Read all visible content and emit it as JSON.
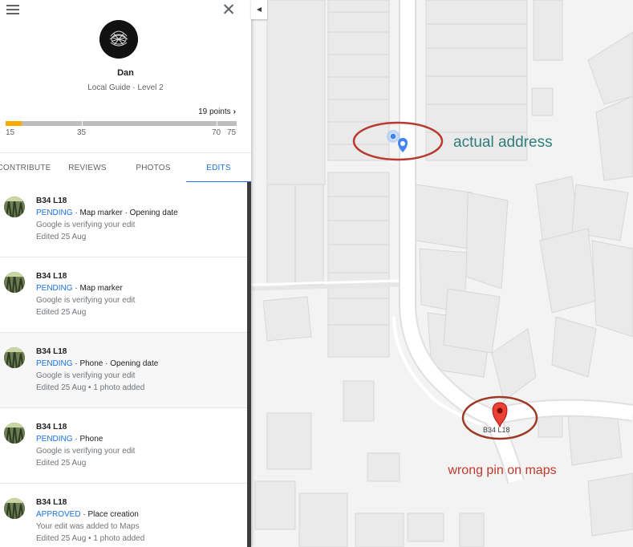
{
  "profile": {
    "name": "Dan",
    "level": "Local Guide · Level 2",
    "points": "19 points",
    "progress_fraction": 0.07,
    "progress_ticks": [
      "15",
      "35",
      "70",
      "75"
    ]
  },
  "tabs": [
    {
      "label": "CONTRIBUTE"
    },
    {
      "label": "REVIEWS"
    },
    {
      "label": "PHOTOS"
    },
    {
      "label": "EDITS",
      "active": true
    }
  ],
  "edits": [
    {
      "title": "B34 L18",
      "status": "PENDING",
      "detail": " · Map marker · Opening date",
      "note": "Google is verifying your edit",
      "date": "Edited 25 Aug"
    },
    {
      "title": "B34 L18",
      "status": "PENDING",
      "detail": " · Map marker",
      "note": "Google is verifying your edit",
      "date": "Edited 25 Aug"
    },
    {
      "title": "B34 L18",
      "status": "PENDING",
      "detail": " · Phone · Opening date",
      "note": "Google is verifying your edit",
      "date": "Edited 25 Aug • 1 photo added"
    },
    {
      "title": "B34 L18",
      "status": "PENDING",
      "detail": " · Phone",
      "note": "Google is verifying your edit",
      "date": "Edited 25 Aug"
    },
    {
      "title": "B34 L18",
      "status": "APPROVED",
      "detail": " · Place creation",
      "note": "Your edit was added to Maps",
      "date": "Edited 25 Aug • 1 photo added"
    }
  ],
  "map": {
    "pin_label": "B34 L18",
    "annotation_actual": "actual address",
    "annotation_wrong": "wrong pin on maps"
  },
  "icons": {
    "menu": "menu-icon",
    "close": "close-icon",
    "collapse": "chevron-left-icon",
    "location_pin": "home-pin-icon",
    "current_location": "location-dot-icon",
    "wrong_pin": "red-pin-icon"
  },
  "colors": {
    "accent": "#1a73e8",
    "progress": "#f9ab00",
    "annotation_actual": "#2e7d7d",
    "annotation_wrong": "#c0392b",
    "pin_red": "#ea4335"
  }
}
